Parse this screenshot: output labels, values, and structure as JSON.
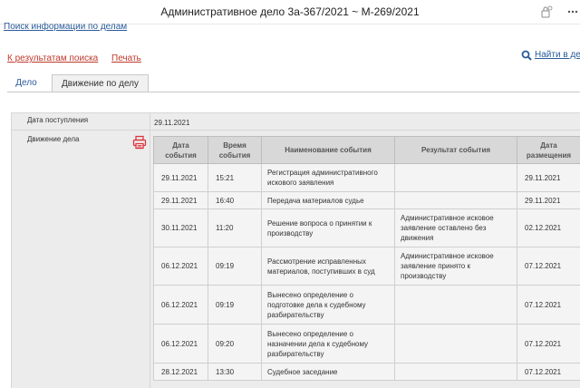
{
  "window": {
    "title": "Административное дело 3а-367/2021 ~ М-269/2021"
  },
  "links": {
    "search": "Поиск информации по делам",
    "back": "К результатам поиска",
    "print": "Печать",
    "find": "Найти в деле"
  },
  "tabs": [
    {
      "label": "Дело",
      "active": false
    },
    {
      "label": "Движение по делу",
      "active": true
    }
  ],
  "case": {
    "receipt_label": "Дата поступления",
    "receipt_date": "29.11.2021",
    "movement_label": "Движение дела"
  },
  "table": {
    "headers": [
      "Дата события",
      "Время события",
      "Наименование события",
      "Результат события",
      "Дата размещения"
    ],
    "rows": [
      {
        "date": "29.11.2021",
        "time": "15:21",
        "name": "Регистрация административного искового заявления",
        "result": "",
        "published": "29.11.2021"
      },
      {
        "date": "29.11.2021",
        "time": "16:40",
        "name": "Передача материалов судье",
        "result": "",
        "published": "29.11.2021"
      },
      {
        "date": "30.11.2021",
        "time": "11:20",
        "name": "Решение вопроса о принятии к производству",
        "result": "Административное исковое заявление оставлено без движения",
        "published": "02.12.2021"
      },
      {
        "date": "06.12.2021",
        "time": "09:19",
        "name": "Рассмотрение исправленных материалов, поступивших в суд",
        "result": "Административное исковое заявление принято к производству",
        "published": "07.12.2021"
      },
      {
        "date": "06.12.2021",
        "time": "09:19",
        "name": "Вынесено определение о подготовке дела к судебному разбирательству",
        "result": "",
        "published": "07.12.2021"
      },
      {
        "date": "06.12.2021",
        "time": "09:20",
        "name": "Вынесено определение о назначении дела к судебному разбирательству",
        "result": "",
        "published": "07.12.2021"
      },
      {
        "date": "28.12.2021",
        "time": "13:30",
        "name": "Судебное заседание",
        "result": "",
        "published": "07.12.2021"
      }
    ]
  },
  "icons": {
    "lock": "lock-icon",
    "more": "more-options-icon",
    "search": "magnifier-icon",
    "printer": "printer-icon"
  },
  "colors": {
    "link_blue": "#2a5b9a",
    "link_red": "#c0392b",
    "printer_red": "#d9363e",
    "header_gray": "#d8d8d8"
  }
}
